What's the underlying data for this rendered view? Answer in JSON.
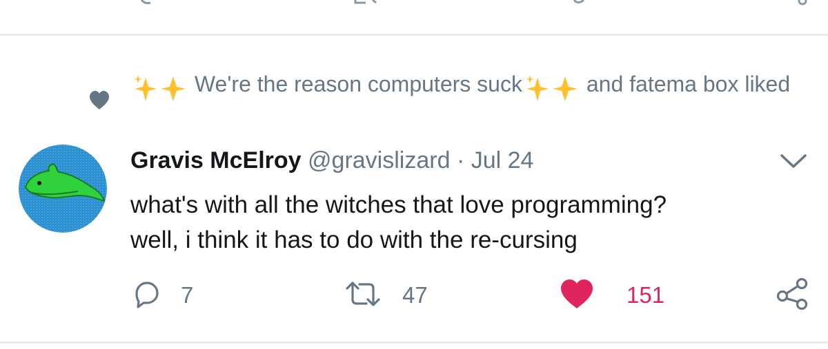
{
  "social_context": {
    "liker_one": "We're the reason computers suck",
    "connector": "and fatema box",
    "action": "liked"
  },
  "tweet": {
    "display_name": "Gravis McElroy",
    "handle": "@gravislizard",
    "separator": "·",
    "date": "Jul 24",
    "body_lines": [
      "what's with all the witches that love programming?",
      "well, i think it has to do with the re-cursing"
    ]
  },
  "actions": {
    "reply_count": "7",
    "retweet_count": "47",
    "like_count": "151"
  },
  "colors": {
    "secondary_text": "#657786",
    "primary_text": "#14171a",
    "like_active": "#e0245e",
    "divider": "#e6ecf0",
    "sparkle": "#ffc02e"
  },
  "icons": [
    "heart-icon",
    "sparkles-icon",
    "chevron-down-icon",
    "reply-icon",
    "retweet-icon",
    "like-icon",
    "share-icon"
  ]
}
